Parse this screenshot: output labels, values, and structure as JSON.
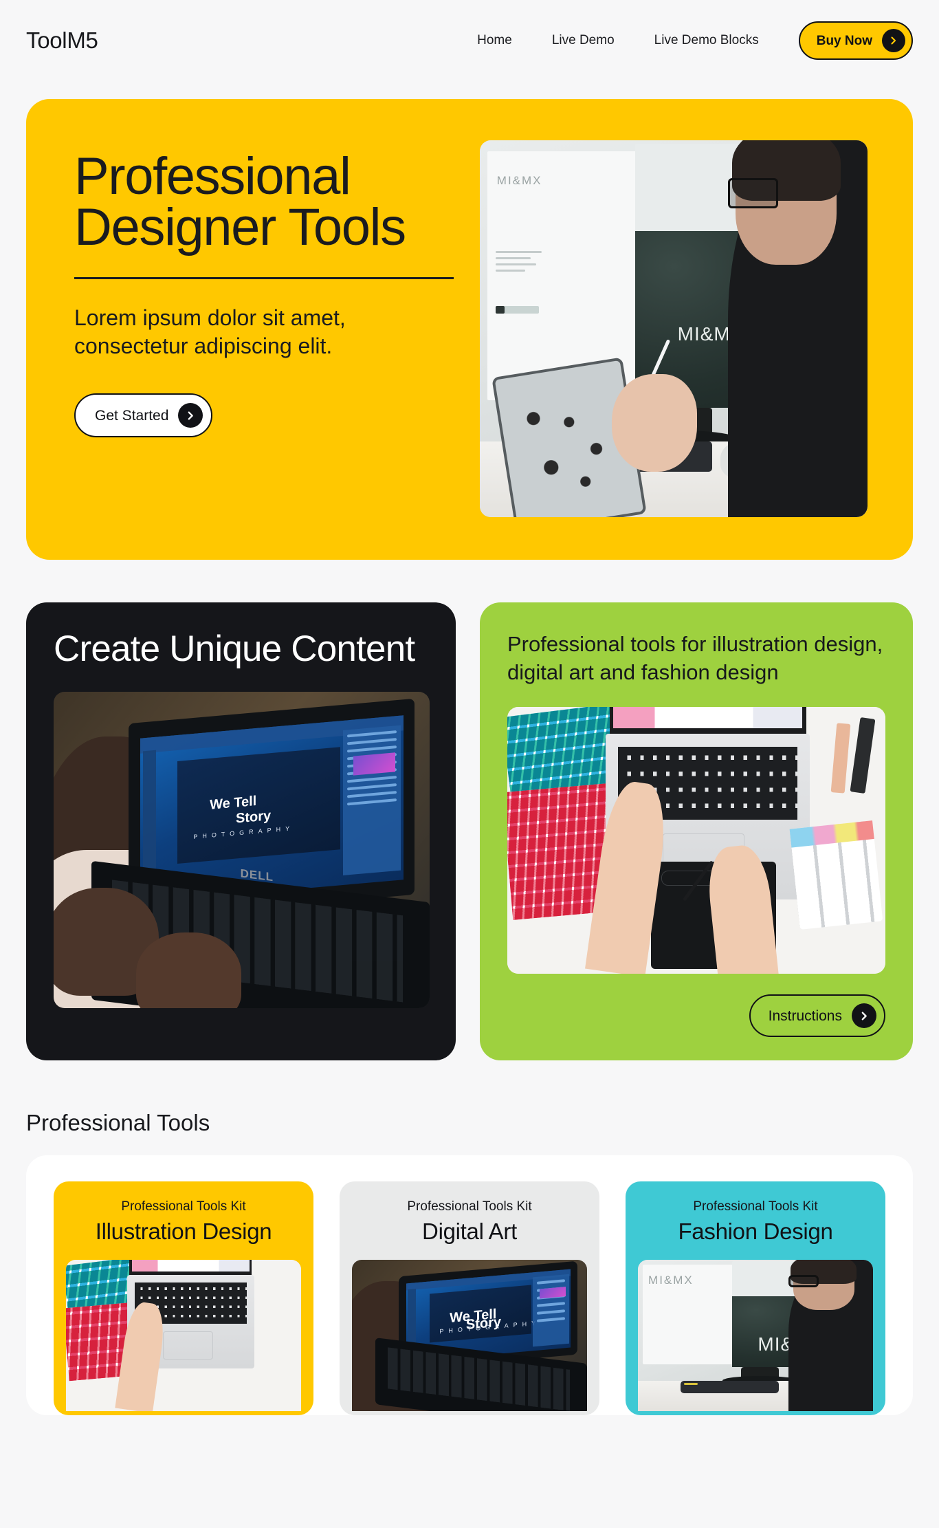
{
  "nav": {
    "brand": "ToolM5",
    "links": [
      {
        "label": "Home"
      },
      {
        "label": "Live Demo"
      },
      {
        "label": "Live Demo Blocks"
      }
    ],
    "cta": {
      "label": "Buy Now",
      "icon": "arrow-right-circle-icon"
    }
  },
  "hero": {
    "title": "Professional Designer Tools",
    "subtitle": "Lorem ipsum dolor sit amet, consectetur adipiscing elit.",
    "cta": {
      "label": "Get Started",
      "icon": "arrow-right-circle-icon"
    },
    "image_alt": "Designer with glasses drawing on a tablet at a desk with two monitors showing MI&MX",
    "monitor_left_brand": "MI&MX",
    "monitor_right_brand": "MI&M",
    "monitor_right_brand_top": "MI&"
  },
  "feature_cards": {
    "dark": {
      "title": "Create Unique Content",
      "image_alt": "Person using a Dell laptop running Photoshop",
      "screen_text_line1": "We Tell",
      "screen_text_line2": "Story",
      "screen_text_line3": "PHOTOGRAPHY",
      "laptop_brand": "DELL"
    },
    "green": {
      "title": "Professional tools for illustration design, digital art and fashion design",
      "image_alt": "Designer hands on a laptop with color swatch fans, graphics tablet and markers",
      "cta": {
        "label": "Instructions",
        "icon": "arrow-right-circle-icon"
      }
    }
  },
  "products": {
    "section_title": "Professional Tools",
    "items": [
      {
        "kit_label": "Professional Tools Kit",
        "name": "Illustration Design",
        "theme": "kit-yellow",
        "thumb": "color-swatch-desk"
      },
      {
        "kit_label": "Professional Tools Kit",
        "name": "Digital Art",
        "theme": "kit-grey",
        "thumb": "dell-photoshop"
      },
      {
        "kit_label": "Professional Tools Kit",
        "name": "Fashion Design",
        "theme": "kit-teal",
        "thumb": "designer-desk"
      }
    ]
  },
  "colors": {
    "page_bg": "#f7f7f8",
    "yellow": "#ffc800",
    "green": "#9ed13f",
    "teal": "#3fc9d4",
    "dark": "#15161a",
    "grey_card": "#e9eaea",
    "text": "#17181c"
  }
}
